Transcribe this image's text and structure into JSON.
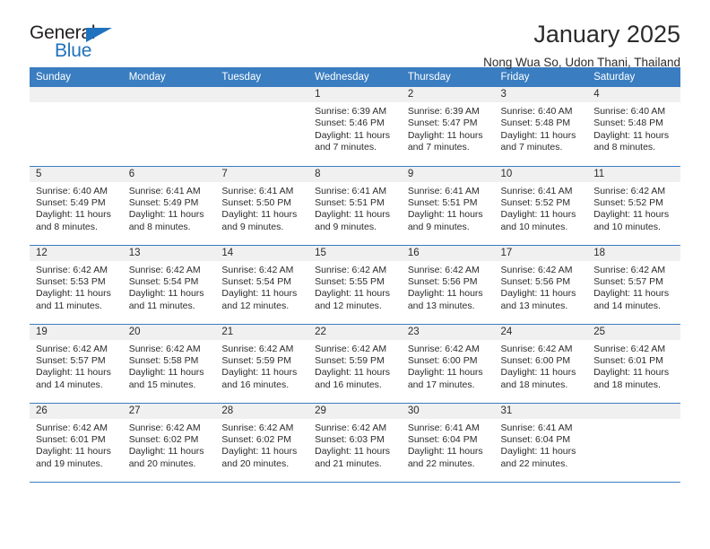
{
  "brand": {
    "name_part1": "General",
    "name_part2": "Blue",
    "flag_icon": "triangle-flag-icon"
  },
  "header": {
    "title": "January 2025",
    "subtitle": "Nong Wua So, Udon Thani, Thailand"
  },
  "colors": {
    "header_blue": "#3a7dc0",
    "daynum_band": "#f0f0f0",
    "brand_blue": "#1f72bd",
    "text": "#2b2b2b"
  },
  "weekday_headers": [
    "Sunday",
    "Monday",
    "Tuesday",
    "Wednesday",
    "Thursday",
    "Friday",
    "Saturday"
  ],
  "labels": {
    "sunrise": "Sunrise:",
    "sunset": "Sunset:",
    "daylight": "Daylight:"
  },
  "weeks": [
    [
      {
        "day": "",
        "empty": true
      },
      {
        "day": "",
        "empty": true
      },
      {
        "day": "",
        "empty": true
      },
      {
        "day": "1",
        "sunrise": "Sunrise: 6:39 AM",
        "sunset": "Sunset: 5:46 PM",
        "daylight": "Daylight: 11 hours and 7 minutes."
      },
      {
        "day": "2",
        "sunrise": "Sunrise: 6:39 AM",
        "sunset": "Sunset: 5:47 PM",
        "daylight": "Daylight: 11 hours and 7 minutes."
      },
      {
        "day": "3",
        "sunrise": "Sunrise: 6:40 AM",
        "sunset": "Sunset: 5:48 PM",
        "daylight": "Daylight: 11 hours and 7 minutes."
      },
      {
        "day": "4",
        "sunrise": "Sunrise: 6:40 AM",
        "sunset": "Sunset: 5:48 PM",
        "daylight": "Daylight: 11 hours and 8 minutes."
      }
    ],
    [
      {
        "day": "5",
        "sunrise": "Sunrise: 6:40 AM",
        "sunset": "Sunset: 5:49 PM",
        "daylight": "Daylight: 11 hours and 8 minutes."
      },
      {
        "day": "6",
        "sunrise": "Sunrise: 6:41 AM",
        "sunset": "Sunset: 5:49 PM",
        "daylight": "Daylight: 11 hours and 8 minutes."
      },
      {
        "day": "7",
        "sunrise": "Sunrise: 6:41 AM",
        "sunset": "Sunset: 5:50 PM",
        "daylight": "Daylight: 11 hours and 9 minutes."
      },
      {
        "day": "8",
        "sunrise": "Sunrise: 6:41 AM",
        "sunset": "Sunset: 5:51 PM",
        "daylight": "Daylight: 11 hours and 9 minutes."
      },
      {
        "day": "9",
        "sunrise": "Sunrise: 6:41 AM",
        "sunset": "Sunset: 5:51 PM",
        "daylight": "Daylight: 11 hours and 9 minutes."
      },
      {
        "day": "10",
        "sunrise": "Sunrise: 6:41 AM",
        "sunset": "Sunset: 5:52 PM",
        "daylight": "Daylight: 11 hours and 10 minutes."
      },
      {
        "day": "11",
        "sunrise": "Sunrise: 6:42 AM",
        "sunset": "Sunset: 5:52 PM",
        "daylight": "Daylight: 11 hours and 10 minutes."
      }
    ],
    [
      {
        "day": "12",
        "sunrise": "Sunrise: 6:42 AM",
        "sunset": "Sunset: 5:53 PM",
        "daylight": "Daylight: 11 hours and 11 minutes."
      },
      {
        "day": "13",
        "sunrise": "Sunrise: 6:42 AM",
        "sunset": "Sunset: 5:54 PM",
        "daylight": "Daylight: 11 hours and 11 minutes."
      },
      {
        "day": "14",
        "sunrise": "Sunrise: 6:42 AM",
        "sunset": "Sunset: 5:54 PM",
        "daylight": "Daylight: 11 hours and 12 minutes."
      },
      {
        "day": "15",
        "sunrise": "Sunrise: 6:42 AM",
        "sunset": "Sunset: 5:55 PM",
        "daylight": "Daylight: 11 hours and 12 minutes."
      },
      {
        "day": "16",
        "sunrise": "Sunrise: 6:42 AM",
        "sunset": "Sunset: 5:56 PM",
        "daylight": "Daylight: 11 hours and 13 minutes."
      },
      {
        "day": "17",
        "sunrise": "Sunrise: 6:42 AM",
        "sunset": "Sunset: 5:56 PM",
        "daylight": "Daylight: 11 hours and 13 minutes."
      },
      {
        "day": "18",
        "sunrise": "Sunrise: 6:42 AM",
        "sunset": "Sunset: 5:57 PM",
        "daylight": "Daylight: 11 hours and 14 minutes."
      }
    ],
    [
      {
        "day": "19",
        "sunrise": "Sunrise: 6:42 AM",
        "sunset": "Sunset: 5:57 PM",
        "daylight": "Daylight: 11 hours and 14 minutes."
      },
      {
        "day": "20",
        "sunrise": "Sunrise: 6:42 AM",
        "sunset": "Sunset: 5:58 PM",
        "daylight": "Daylight: 11 hours and 15 minutes."
      },
      {
        "day": "21",
        "sunrise": "Sunrise: 6:42 AM",
        "sunset": "Sunset: 5:59 PM",
        "daylight": "Daylight: 11 hours and 16 minutes."
      },
      {
        "day": "22",
        "sunrise": "Sunrise: 6:42 AM",
        "sunset": "Sunset: 5:59 PM",
        "daylight": "Daylight: 11 hours and 16 minutes."
      },
      {
        "day": "23",
        "sunrise": "Sunrise: 6:42 AM",
        "sunset": "Sunset: 6:00 PM",
        "daylight": "Daylight: 11 hours and 17 minutes."
      },
      {
        "day": "24",
        "sunrise": "Sunrise: 6:42 AM",
        "sunset": "Sunset: 6:00 PM",
        "daylight": "Daylight: 11 hours and 18 minutes."
      },
      {
        "day": "25",
        "sunrise": "Sunrise: 6:42 AM",
        "sunset": "Sunset: 6:01 PM",
        "daylight": "Daylight: 11 hours and 18 minutes."
      }
    ],
    [
      {
        "day": "26",
        "sunrise": "Sunrise: 6:42 AM",
        "sunset": "Sunset: 6:01 PM",
        "daylight": "Daylight: 11 hours and 19 minutes."
      },
      {
        "day": "27",
        "sunrise": "Sunrise: 6:42 AM",
        "sunset": "Sunset: 6:02 PM",
        "daylight": "Daylight: 11 hours and 20 minutes."
      },
      {
        "day": "28",
        "sunrise": "Sunrise: 6:42 AM",
        "sunset": "Sunset: 6:02 PM",
        "daylight": "Daylight: 11 hours and 20 minutes."
      },
      {
        "day": "29",
        "sunrise": "Sunrise: 6:42 AM",
        "sunset": "Sunset: 6:03 PM",
        "daylight": "Daylight: 11 hours and 21 minutes."
      },
      {
        "day": "30",
        "sunrise": "Sunrise: 6:41 AM",
        "sunset": "Sunset: 6:04 PM",
        "daylight": "Daylight: 11 hours and 22 minutes."
      },
      {
        "day": "31",
        "sunrise": "Sunrise: 6:41 AM",
        "sunset": "Sunset: 6:04 PM",
        "daylight": "Daylight: 11 hours and 22 minutes."
      },
      {
        "day": "",
        "empty": true
      }
    ]
  ]
}
